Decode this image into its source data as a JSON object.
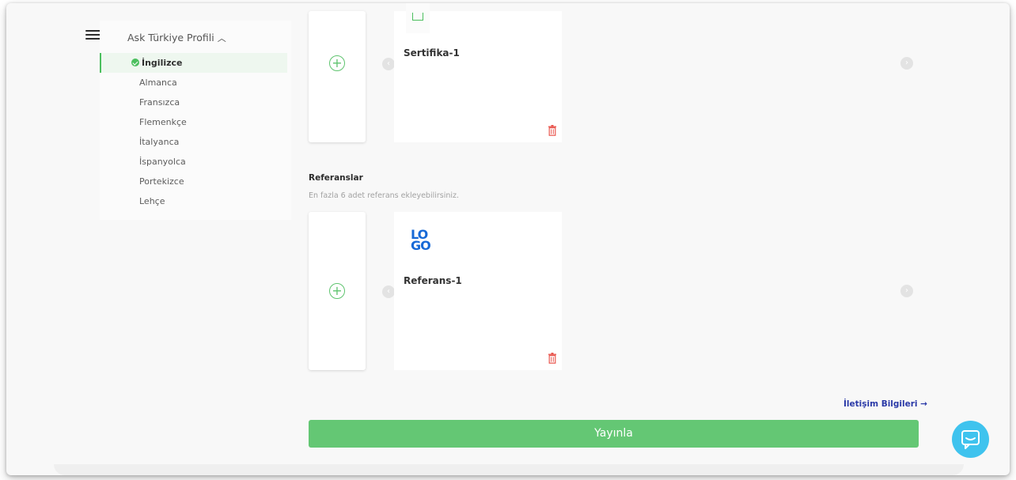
{
  "sidebar": {
    "title": "Ask Türkiye Profili",
    "languages": [
      {
        "label": "İngilizce",
        "active": true
      },
      {
        "label": "Almanca",
        "active": false
      },
      {
        "label": "Fransızca",
        "active": false
      },
      {
        "label": "Flemenkçe",
        "active": false
      },
      {
        "label": "İtalyanca",
        "active": false
      },
      {
        "label": "İspanyolca",
        "active": false
      },
      {
        "label": "Portekizce",
        "active": false
      },
      {
        "label": "Lehçe",
        "active": false
      }
    ]
  },
  "certificates": {
    "items": [
      {
        "title": "Sertifika-1"
      }
    ]
  },
  "references": {
    "heading": "Referanslar",
    "subtitle": "En fazla 6 adet referans ekleyebilirsiniz.",
    "logo_text": "LOGO",
    "items": [
      {
        "title": "Referans-1"
      }
    ]
  },
  "footer": {
    "next_link": "İletişim Bilgileri →",
    "publish_button": "Yayınla"
  },
  "colors": {
    "accent_green": "#64c774",
    "link_blue": "#2b3aa8",
    "delete_red": "#e9574f",
    "chat_blue": "#3fc3ee"
  },
  "icons": {
    "menu": "hamburger-icon",
    "expand": "chevron-up-icon",
    "add": "plus-circle-icon",
    "prev": "chevron-left-icon",
    "next": "chevron-right-icon",
    "delete": "trash-icon",
    "chat": "chat-bubble-icon"
  }
}
